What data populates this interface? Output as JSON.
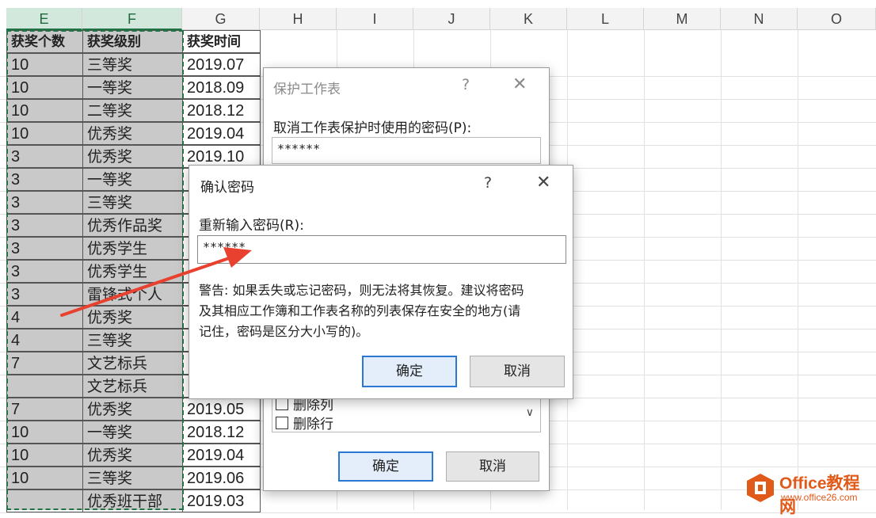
{
  "columns": [
    "E",
    "F",
    "G",
    "H",
    "I",
    "J",
    "K",
    "L",
    "M",
    "N",
    "O"
  ],
  "headers": {
    "e": "获奖个数",
    "f": "获奖级别",
    "g": "获奖时间"
  },
  "rows": [
    {
      "e": "10",
      "f": "三等奖",
      "g": "2019.07"
    },
    {
      "e": "10",
      "f": "一等奖",
      "g": "2018.09"
    },
    {
      "e": "10",
      "f": "二等奖",
      "g": "2018.12"
    },
    {
      "e": "10",
      "f": "优秀奖",
      "g": "2019.04"
    },
    {
      "e": "3",
      "f": "优秀奖",
      "g": "2019.10"
    },
    {
      "e": "3",
      "f": "一等奖",
      "g": ""
    },
    {
      "e": "3",
      "f": "三等奖",
      "g": ""
    },
    {
      "e": "3",
      "f": "优秀作品奖",
      "g": ""
    },
    {
      "e": "3",
      "f": "优秀学生",
      "g": ""
    },
    {
      "e": "3",
      "f": "优秀学生",
      "g": ""
    },
    {
      "e": "3",
      "f": "雷锋式个人",
      "g": ""
    },
    {
      "e": "4",
      "f": "优秀奖",
      "g": ""
    },
    {
      "e": "4",
      "f": "三等奖",
      "g": ""
    },
    {
      "e": "7",
      "f": "文艺标兵",
      "g": ""
    },
    {
      "e": "",
      "f": "文艺标兵",
      "g": ""
    },
    {
      "e": "7",
      "f": "优秀奖",
      "g": "2019.05"
    },
    {
      "e": "10",
      "f": "一等奖",
      "g": "2018.12"
    },
    {
      "e": "10",
      "f": "优秀奖",
      "g": "2019.04"
    },
    {
      "e": "10",
      "f": "三等奖",
      "g": "2019.06"
    },
    {
      "e": "",
      "f": "优秀班干部",
      "g": "2019.03"
    }
  ],
  "protect_dialog": {
    "title": "保护工作表",
    "help": "?",
    "close": "✕",
    "password_label": "取消工作表保护时使用的密码(P):",
    "password_value": "******",
    "options": [
      "删除列",
      "删除行"
    ],
    "ok_label": "确定",
    "cancel_label": "取消"
  },
  "confirm_dialog": {
    "title": "确认密码",
    "help": "?",
    "close": "✕",
    "reenter_label": "重新输入密码(R):",
    "password_value": "******",
    "warning_lines": [
      "警告: 如果丢失或忘记密码，则无法将其恢复。建议将密码",
      "及其相应工作簿和工作表名称的列表保存在安全的地方(请",
      "记住，密码是区分大小写的)。"
    ],
    "ok_label": "确定",
    "cancel_label": "取消"
  },
  "logo": {
    "name": "Office教程网",
    "url": "www.office26.com"
  },
  "colors": {
    "arrow": "#e8412f",
    "excel_green": "#217346",
    "logo": "#e05a1a"
  }
}
